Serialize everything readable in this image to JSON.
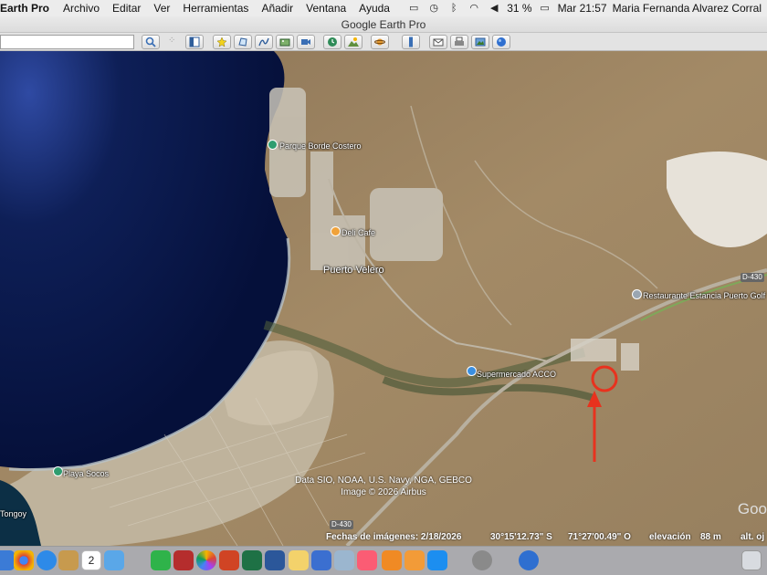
{
  "menubar": {
    "app_name": "Earth Pro",
    "menus": [
      "Archivo",
      "Editar",
      "Ver",
      "Herramientas",
      "Añadir",
      "Ventana",
      "Ayuda"
    ],
    "battery": "31 %",
    "clock": "Mar 21:57",
    "user": "Maria Fernanda Alvarez Corral"
  },
  "window": {
    "title": "Google Earth Pro"
  },
  "toolbar": {
    "search_value": "",
    "buttons": [
      "search-icon",
      "sidebar-icon",
      "placemark-icon",
      "polygon-icon",
      "path-icon",
      "overlay-icon",
      "tour-icon",
      "historical-imagery-icon",
      "sunlight-icon",
      "planets-icon",
      "ruler-icon",
      "email-icon",
      "print-icon",
      "save-image-icon",
      "maps-icon"
    ]
  },
  "map": {
    "labels": {
      "parque": "Parque Borde Costero",
      "deli": "Deli Cafe",
      "puerto": "Puerto Velero",
      "super": "Supermercado ACCO",
      "restaurante": "Restaurante Estancia Puerto Golf",
      "playa": "Playa Socos",
      "tongoy": "Tongoy"
    },
    "road_shields": [
      "D-430",
      "D-430"
    ],
    "credit_line1": "Data SIO, NOAA, U.S. Navy, NGA, GEBCO",
    "credit_line2": "Image © 2026 Airbus",
    "google_mark": "Goo"
  },
  "status": {
    "imagery_date": "Fechas de imágenes: 2/18/2026",
    "lat": "30°15'12.73\" S",
    "lon": "71°27'00.49\" O",
    "elev_label": "elevación",
    "elev_value": "88 m",
    "alt": "alt. oj"
  },
  "annotation": {
    "circle_color": "#e8321e",
    "arrow_color": "#e8321e"
  },
  "dock": {
    "items": [
      "finder-icon",
      "chrome-icon",
      "safari-icon",
      "notes-icon",
      "calendar-icon",
      "files-icon",
      "facetime-icon",
      "photo-booth-icon",
      "photos-icon",
      "powerpoint-icon",
      "excel-icon",
      "word-icon",
      "notes-app-icon",
      "keynote-icon",
      "preview-icon",
      "music-icon",
      "vlc-icon",
      "books-icon",
      "app-store-icon",
      "system-prefs-icon",
      "google-earth-icon",
      "trash-icon"
    ],
    "calendar_day": "2"
  }
}
